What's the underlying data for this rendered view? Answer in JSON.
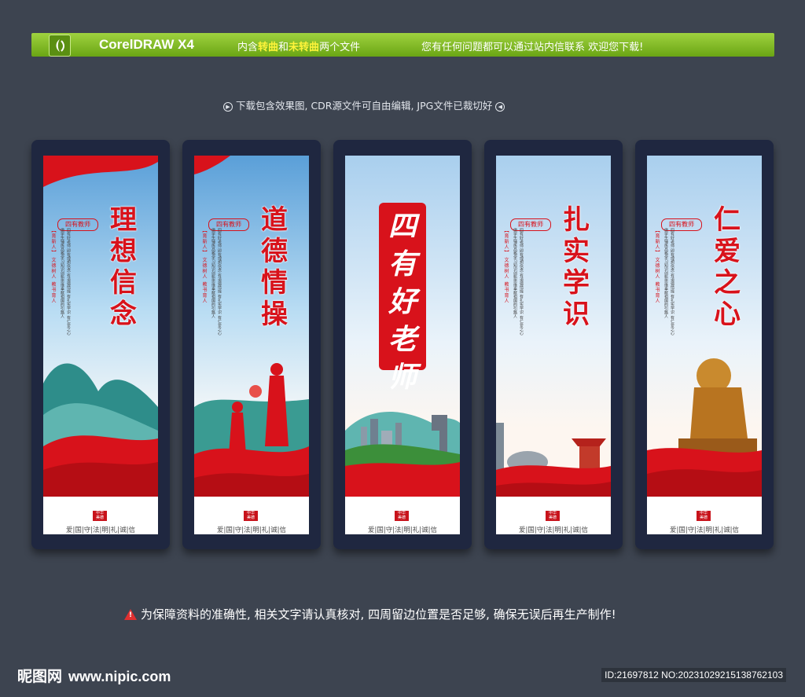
{
  "header": {
    "app_title": "CorelDRAW X4",
    "contains_prefix": "内含",
    "curve_label": "转曲",
    "and_label": "和",
    "no_curve_label": "未转曲",
    "files_suffix": "两个文件",
    "contact_text": "您有任何问题都可以通过站内信联系   欢迎您下载!"
  },
  "subline": "下载包含效果图, CDR源文件可自由编辑, JPG文件已裁切好",
  "panels": [
    {
      "title": "理想信念",
      "seal": "四有教师",
      "tag": "【育新人】 文德树人 教书育人",
      "copy": "四有好老师 即有理想信念 有道德情操 有扎实学识 有仁爱之心 做学生锤炼品格学习知识创新思维奉献祖国的引路人",
      "footer": "爱|国|守|法|明|礼|诚|信"
    },
    {
      "title": "道德情操",
      "seal": "四有教师",
      "tag": "【育新人】 文德树人 教书育人",
      "copy": "四有好老师 即有理想信念 有道德情操 有扎实学识 有仁爱之心 做学生锤炼品格学习知识创新思维奉献祖国的引路人",
      "footer": "爱|国|守|法|明|礼|诚|信"
    },
    {
      "title": "四有好老师",
      "footer": "爱|国|守|法|明|礼|诚|信"
    },
    {
      "title": "扎实学识",
      "seal": "四有教师",
      "tag": "【育新人】 文德树人 教书育人",
      "copy": "四有好老师 即有理想信念 有道德情操 有扎实学识 有仁爱之心 做学生锤炼品格学习知识创新思维奉献祖国的引路人",
      "footer": "爱|国|守|法|明|礼|诚|信"
    },
    {
      "title": "仁爱之心",
      "seal": "四有教师",
      "tag": "【育新人】 文德树人 教书育人",
      "copy": "四有好老师 即有理想信念 有道德情操 有扎实学识 有仁爱之心 做学生锤炼品格学习知识创新思维奉献祖国的引路人",
      "footer": "爱|国|守|法|明|礼|诚|信"
    }
  ],
  "notice": "为保障资料的准确性, 相关文字请认真核对, 四周留边位置是否足够, 确保无误后再生产制作!",
  "watermark": {
    "site_name": "昵图网",
    "url": "www.nipic.com",
    "id_text": "ID:21697812 NO:20231029215138762103"
  },
  "colors": {
    "accent_red": "#d8121b",
    "bar_green": "#7fbb22",
    "background": "#3d4450"
  }
}
